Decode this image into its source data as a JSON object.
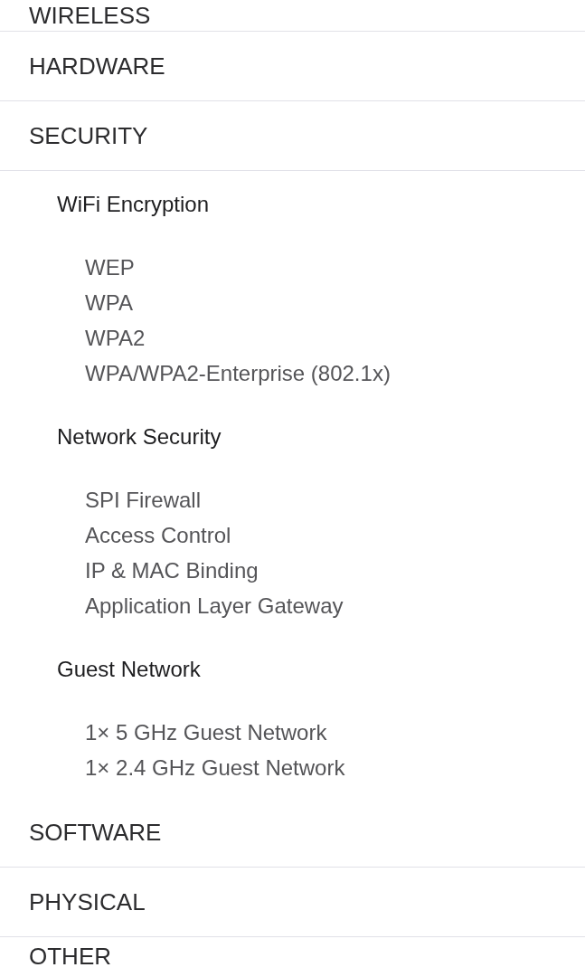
{
  "sections": [
    {
      "title": "WIRELESS"
    },
    {
      "title": "HARDWARE"
    },
    {
      "title": "SECURITY",
      "groups": [
        {
          "title": "WiFi Encryption",
          "items": [
            "WEP",
            "WPA",
            "WPA2",
            "WPA/WPA2-Enterprise (802.1x)"
          ]
        },
        {
          "title": "Network Security",
          "items": [
            "SPI Firewall",
            "Access Control",
            "IP & MAC Binding",
            "Application Layer Gateway"
          ]
        },
        {
          "title": "Guest Network",
          "items": [
            "1× 5 GHz Guest Network",
            "1× 2.4 GHz Guest Network"
          ]
        }
      ]
    },
    {
      "title": "SOFTWARE"
    },
    {
      "title": "PHYSICAL"
    },
    {
      "title": "OTHER"
    }
  ]
}
